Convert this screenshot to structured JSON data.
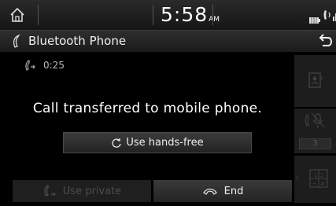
{
  "status_bar": {
    "time": "5:58",
    "ampm": "AM"
  },
  "title_bar": {
    "title": "Bluetooth Phone"
  },
  "call": {
    "duration": "0:25",
    "message": "Call transferred to mobile phone."
  },
  "buttons": {
    "use_handsfree": "Use hands-free",
    "use_private": "Use private",
    "end": "End"
  },
  "side_panel": {
    "mute_count": "3"
  },
  "colors": {
    "background": "#000000",
    "button_active": "#3a3a3a",
    "button_disabled_text": "#4c4c4c"
  }
}
